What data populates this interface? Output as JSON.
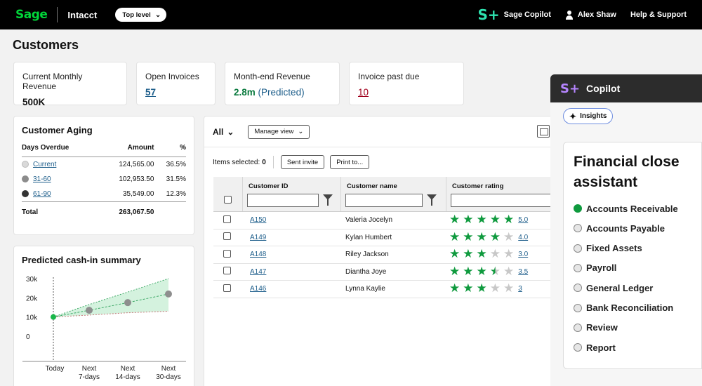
{
  "topbar": {
    "logo": "Sage",
    "product": "Intacct",
    "level": "Top level",
    "copilot_icon": "S+",
    "copilot": "Sage Copilot",
    "user": "Alex Shaw",
    "help": "Help & Support"
  },
  "page": {
    "title": "Customers"
  },
  "kpis": [
    {
      "label": "Current Monthly Revenue",
      "value": "500K"
    },
    {
      "label": "Open Invoices",
      "value": "57"
    },
    {
      "label": "Month-end Revenue",
      "value": "2.8m",
      "note": "(Predicted)"
    },
    {
      "label": "Invoice past due",
      "value": "10"
    }
  ],
  "aging": {
    "title": "Customer Aging",
    "headers": [
      "Days Overdue",
      "Amount",
      "%"
    ],
    "rows": [
      {
        "label": "Current",
        "amount": "124,565.00",
        "pct": "36.5%",
        "color": "#d9d9d9"
      },
      {
        "label": "31-60",
        "amount": "102,953.50",
        "pct": "31.5%",
        "color": "#8c8c8c"
      },
      {
        "label": "61-90",
        "amount": "35,549.00",
        "pct": "12.3%",
        "color": "#333333"
      }
    ],
    "total_label": "Total",
    "total_amount": "263,067.50"
  },
  "predict": {
    "title": "Predicted cash-in summary",
    "chart_data": {
      "type": "line",
      "y_ticks": [
        "30k",
        "20k",
        "10k",
        "0"
      ],
      "ylim": [
        0,
        30000
      ],
      "categories": [
        "Today",
        "Next 7-days",
        "Next 14-days",
        "Next 30-days"
      ],
      "x_labels": [
        [
          "Today"
        ],
        [
          "Next",
          "7-days"
        ],
        [
          "Next",
          "14-days"
        ],
        [
          "Next",
          "30-days"
        ]
      ],
      "points": [
        10000,
        13500,
        17500,
        22000
      ],
      "upper": [
        10000,
        16500,
        23000,
        30000
      ],
      "lower": [
        10000,
        11000,
        12200,
        13000
      ]
    }
  },
  "table": {
    "filter": "All",
    "manage_view": "Manage view",
    "items_selected_label": "Items selected:",
    "items_selected_count": "0",
    "sent_invite": "Sent invite",
    "print_to": "Print to...",
    "headers": [
      "Customer ID",
      "Customer name",
      "Customer rating"
    ],
    "rows": [
      {
        "id": "A150",
        "name": "Valeria Jocelyn",
        "rating": "5.0",
        "stars": 5
      },
      {
        "id": "A149",
        "name": "Kylan Humbert",
        "rating": "4.0",
        "stars": 4
      },
      {
        "id": "A148",
        "name": "Riley Jackson",
        "rating": "3.0",
        "stars": 3
      },
      {
        "id": "A147",
        "name": "Diantha Joye",
        "rating": "3.5",
        "stars": 3.5
      },
      {
        "id": "A146",
        "name": "Lynna Kaylie",
        "rating": "3",
        "stars": 3
      }
    ]
  },
  "copilot": {
    "title": "Copilot",
    "insights": "Insights",
    "assistant_title": "Financial close assistant",
    "steps": [
      {
        "label": "Accounts Receivable",
        "done": true
      },
      {
        "label": "Accounts Payable",
        "done": false
      },
      {
        "label": "Fixed Assets",
        "done": false
      },
      {
        "label": "Payroll",
        "done": false
      },
      {
        "label": "General Ledger",
        "done": false
      },
      {
        "label": "Bank Reconciliation",
        "done": false
      },
      {
        "label": "Review",
        "done": false
      },
      {
        "label": "Report",
        "done": false
      }
    ]
  }
}
